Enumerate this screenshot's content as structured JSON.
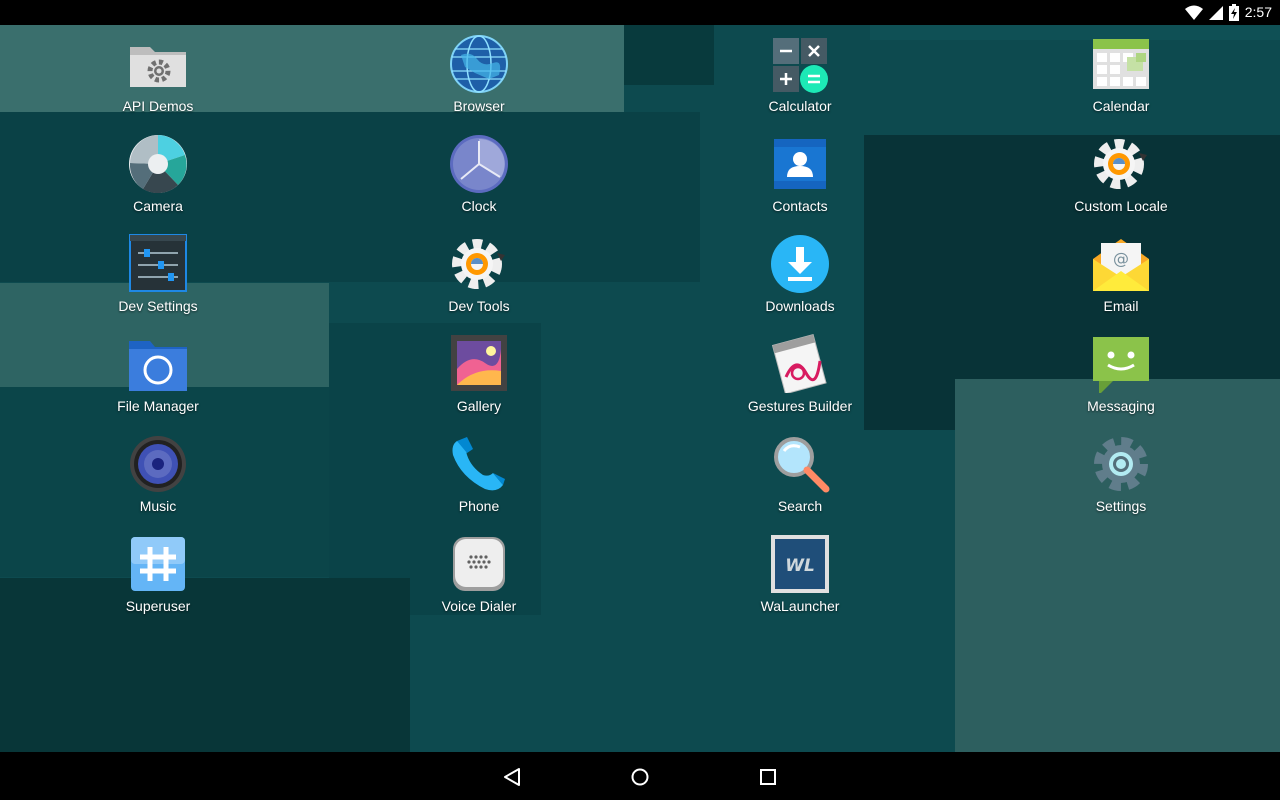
{
  "status_bar": {
    "time": "2:57"
  },
  "apps": [
    {
      "label": "API Demos",
      "icon": "folder-gear-icon"
    },
    {
      "label": "Browser",
      "icon": "globe-icon"
    },
    {
      "label": "Calculator",
      "icon": "calculator-icon"
    },
    {
      "label": "Calendar",
      "icon": "calendar-icon"
    },
    {
      "label": "Camera",
      "icon": "camera-aperture-icon"
    },
    {
      "label": "Clock",
      "icon": "clock-icon"
    },
    {
      "label": "Contacts",
      "icon": "contacts-icon"
    },
    {
      "label": "Custom Locale",
      "icon": "gear-orange-icon"
    },
    {
      "label": "Dev Settings",
      "icon": "sliders-icon"
    },
    {
      "label": "Dev Tools",
      "icon": "gear-orange-icon"
    },
    {
      "label": "Downloads",
      "icon": "download-icon"
    },
    {
      "label": "Email",
      "icon": "email-envelope-icon"
    },
    {
      "label": "File Manager",
      "icon": "folder-icon"
    },
    {
      "label": "Gallery",
      "icon": "gallery-icon"
    },
    {
      "label": "Gestures Builder",
      "icon": "gesture-icon"
    },
    {
      "label": "Messaging",
      "icon": "message-bubble-icon"
    },
    {
      "label": "Music",
      "icon": "speaker-icon"
    },
    {
      "label": "Phone",
      "icon": "phone-icon"
    },
    {
      "label": "Search",
      "icon": "magnifier-icon"
    },
    {
      "label": "Settings",
      "icon": "gear-icon"
    },
    {
      "label": "Superuser",
      "icon": "hash-icon"
    },
    {
      "label": "Voice Dialer",
      "icon": "voice-dialer-icon"
    },
    {
      "label": "WaLauncher",
      "icon": "walauncher-icon"
    }
  ]
}
